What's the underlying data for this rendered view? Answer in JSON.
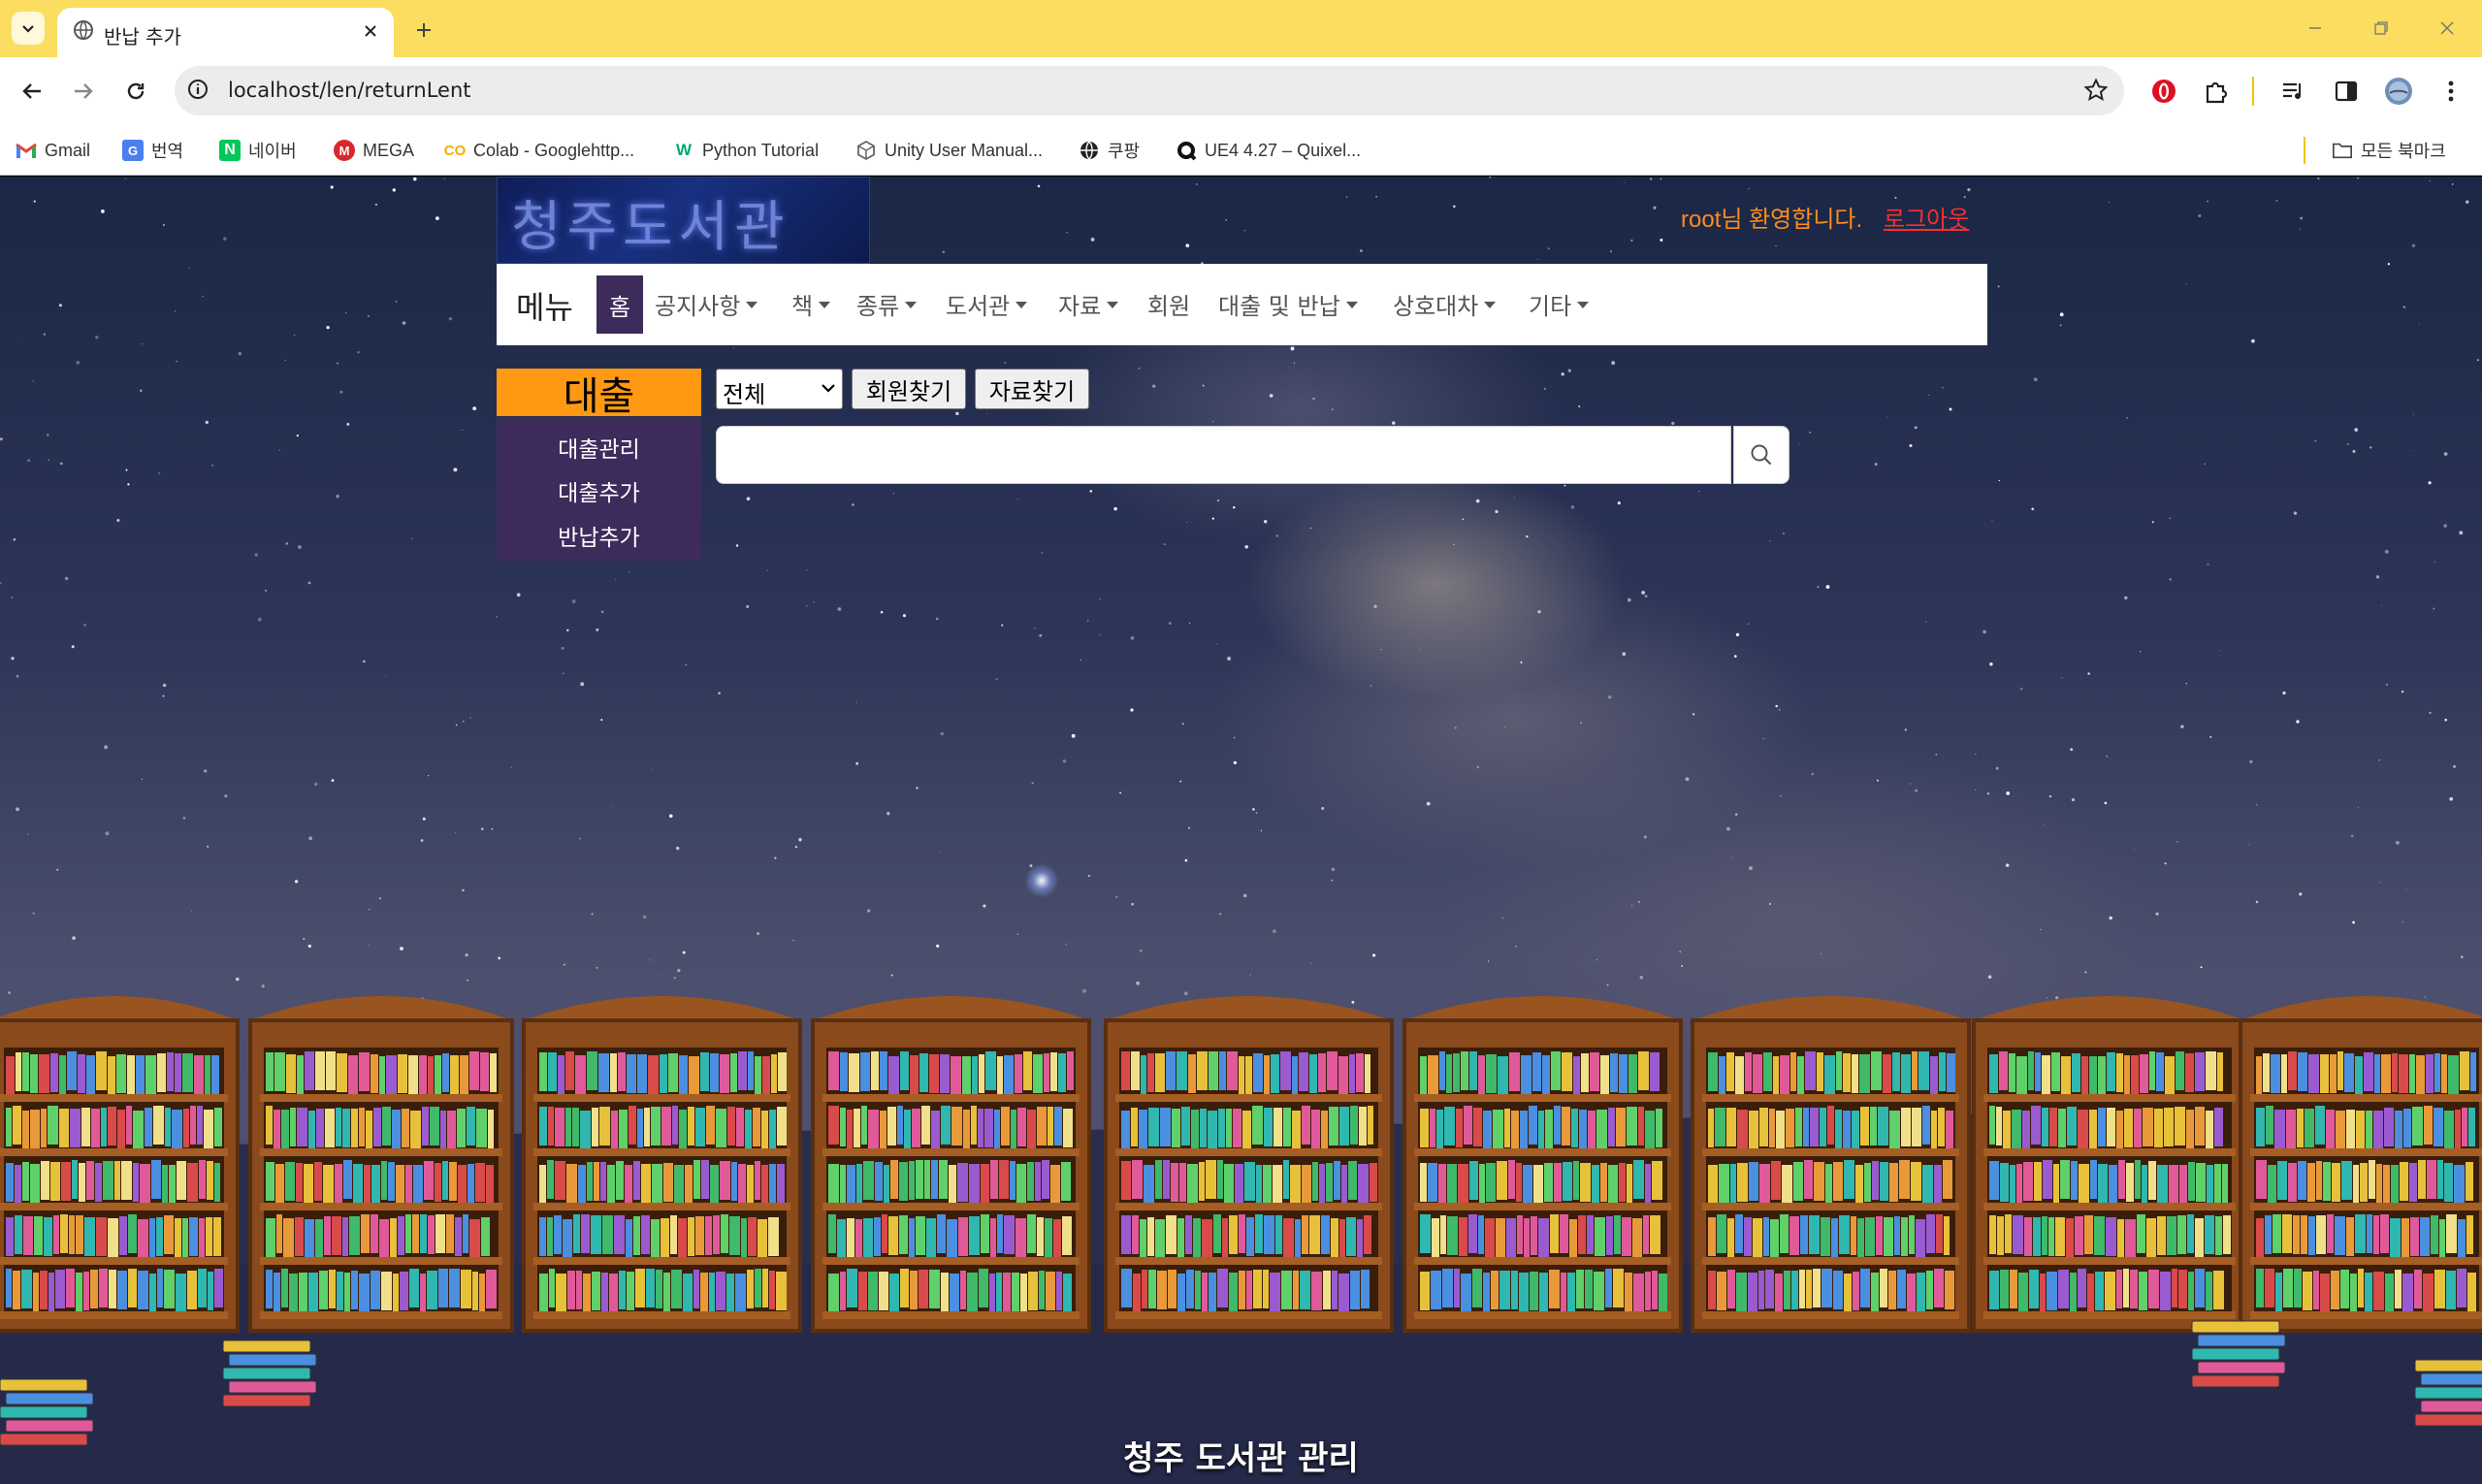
{
  "browser": {
    "tab_title": "반납 추가",
    "url": "localhost/len/returnLent",
    "bookmarks": [
      {
        "label": "Gmail",
        "icon": "gmail-icon"
      },
      {
        "label": "번역",
        "icon": "translate-icon"
      },
      {
        "label": "네이버",
        "icon": "naver-icon"
      },
      {
        "label": "MEGA",
        "icon": "mega-icon"
      },
      {
        "label": "Colab - Googlehttp...",
        "icon": "colab-icon"
      },
      {
        "label": "Python Tutorial",
        "icon": "w3schools-icon"
      },
      {
        "label": "Unity User Manual...",
        "icon": "unity-icon"
      },
      {
        "label": "쿠팡",
        "icon": "globe-icon"
      },
      {
        "label": "UE4 4.27 – Quixel...",
        "icon": "quixel-icon"
      }
    ],
    "all_bookmarks": "모든 북마크"
  },
  "header": {
    "logo_text": "청주도서관",
    "welcome": "root님 환영합니다.",
    "logout": "로그아웃"
  },
  "navbar": {
    "brand": "메뉴",
    "home": "홈",
    "items": [
      {
        "label": "공지사항",
        "dropdown": true
      },
      {
        "label": "책",
        "dropdown": true
      },
      {
        "label": "종류",
        "dropdown": true
      },
      {
        "label": "도서관",
        "dropdown": true
      },
      {
        "label": "자료",
        "dropdown": true
      },
      {
        "label": "회원",
        "dropdown": false
      },
      {
        "label": "대출 및 반납",
        "dropdown": true
      },
      {
        "label": "상호대차",
        "dropdown": true
      },
      {
        "label": "기타",
        "dropdown": true
      }
    ]
  },
  "sidebar": {
    "title": "대출",
    "links": [
      "대출관리",
      "대출추가",
      "반납추가"
    ]
  },
  "search": {
    "select_value": "전체",
    "find_member_button": "회원찾기",
    "find_material_button": "자료찾기",
    "input_value": ""
  },
  "footer": {
    "title": "청주 도서관 관리"
  },
  "colors": {
    "tabstrip": "#fbdd5f",
    "accent_orange": "#ff9913",
    "menu_purple": "#3d2b5c",
    "welcome_orange": "#ff8c1a",
    "logout_red": "#ff2d2d"
  }
}
